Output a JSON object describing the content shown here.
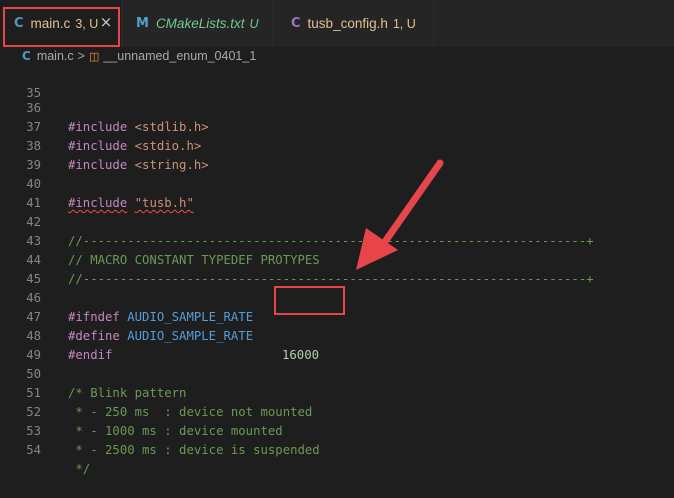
{
  "tabs": [
    {
      "icon": "C",
      "name": "main.c",
      "status": "3, U",
      "icon_color": "#519aba",
      "close": "×"
    },
    {
      "icon": "M",
      "name": "CMakeLists.txt",
      "status": "U",
      "icon_color": "#4fa2c7"
    },
    {
      "icon": "C",
      "name": "tusb_config.h",
      "status": "1, U",
      "icon_color": "#a074c4"
    }
  ],
  "breadcrumb": {
    "icon": "C",
    "file": "main.c",
    "separator": ">",
    "symbol": "__unnamed_enum_0401_1"
  },
  "code_lines": [
    {
      "n": "35"
    },
    {
      "n": "36",
      "kw": "#include",
      "arg": "<stdlib.h>"
    },
    {
      "n": "37",
      "kw": "#include",
      "arg": "<stdio.h>"
    },
    {
      "n": "38",
      "kw": "#include",
      "arg": "<string.h>"
    },
    {
      "n": "39"
    },
    {
      "n": "40",
      "kw": "#include",
      "arg": "\"tusb.h\""
    },
    {
      "n": "41"
    },
    {
      "n": "42",
      "text": "//--------------------------------------------------------------------+"
    },
    {
      "n": "43",
      "text": "// MACRO CONSTANT TYPEDEF PROTYPES"
    },
    {
      "n": "44",
      "text": "//--------------------------------------------------------------------+"
    },
    {
      "n": "45"
    },
    {
      "n": "46",
      "kw": "#ifndef",
      "macro": "AUDIO_SAMPLE_RATE"
    },
    {
      "n": "47",
      "kw": "#define",
      "macro": "AUDIO_SAMPLE_RATE",
      "value": "16000"
    },
    {
      "n": "48",
      "kw": "#endif"
    },
    {
      "n": "49"
    },
    {
      "n": "50",
      "text": "/* Blink pattern"
    },
    {
      "n": "51",
      "text": " * - 250 ms  : device not mounted"
    },
    {
      "n": "52",
      "text": " * - 1000 ms : device mounted"
    },
    {
      "n": "53",
      "text": " * - 2500 ms : device is suspended"
    },
    {
      "n": "54",
      "text": " */"
    }
  ],
  "colors": {
    "annotation": "#e8454b",
    "keyword": "#c586c0",
    "string": "#ce9178",
    "macro": "#569cd6",
    "number": "#b5cea8",
    "comment": "#6a9955"
  }
}
